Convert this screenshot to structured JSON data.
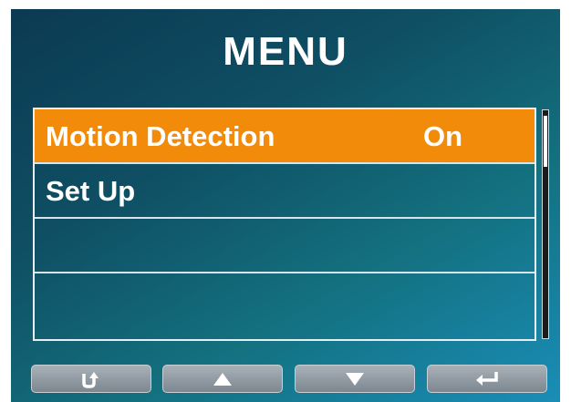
{
  "menu": {
    "title": "MENU",
    "items": [
      {
        "label": "Motion Detection",
        "value": "On",
        "selected": true
      },
      {
        "label": "Set Up",
        "value": "",
        "selected": false
      },
      {
        "label": "",
        "value": "",
        "selected": false
      },
      {
        "label": "",
        "value": "",
        "selected": false
      }
    ]
  },
  "buttons": [
    {
      "icon": "back-arrow-icon"
    },
    {
      "icon": "up-triangle-icon"
    },
    {
      "icon": "down-triangle-icon"
    },
    {
      "icon": "enter-return-icon"
    }
  ],
  "colors": {
    "selected_row": "#f28a0a",
    "screen_dark": "#0b3a52",
    "screen_light": "#1a8db7"
  }
}
